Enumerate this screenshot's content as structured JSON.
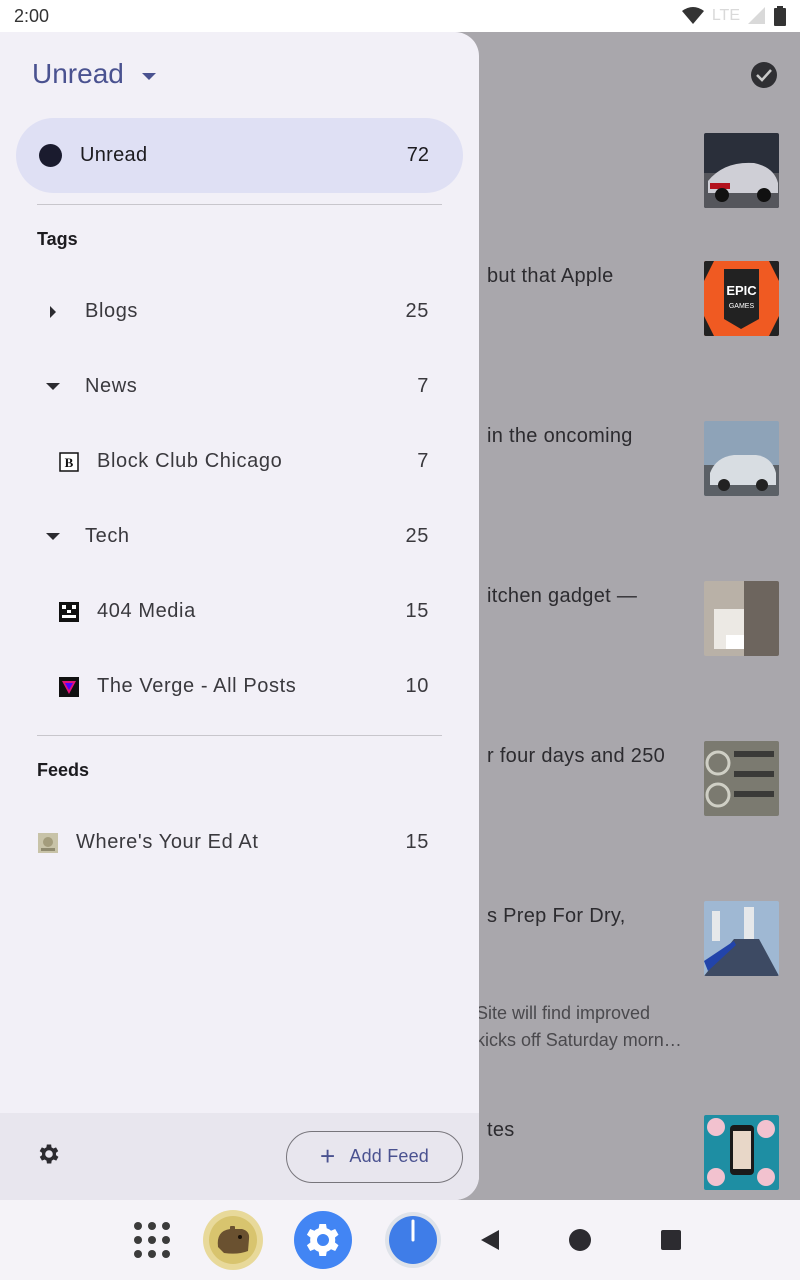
{
  "status_bar": {
    "time": "2:00",
    "network": "LTE"
  },
  "background": {
    "articles": [
      {
        "title": "",
        "thumb_colors": [
          "#2a2f3a",
          "#b3121d",
          "#cfcfd6"
        ]
      },
      {
        "title": "but that Apple",
        "thumb_colors": [
          "#f05a22",
          "#222222",
          "#ffffff"
        ]
      },
      {
        "title": "in the oncoming",
        "thumb_colors": [
          "#8ea3b8",
          "#d8dde2",
          "#5b6066"
        ]
      },
      {
        "title": "itchen gadget —",
        "thumb_colors": [
          "#b9b1a7",
          "#6d655e",
          "#ece9e4"
        ]
      },
      {
        "title": "r four days and 250",
        "thumb_colors": [
          "#7b7a70",
          "#3a3a38",
          "#cfcfc5"
        ]
      },
      {
        "title": "s Prep For Dry,",
        "thumb_colors": [
          "#9fb8d3",
          "#3d4a63",
          "#e6e8ea"
        ]
      },
      {
        "title": "tes",
        "thumb_colors": [
          "#1e8ea3",
          "#f2c2cf",
          "#1a1a1a"
        ]
      }
    ],
    "snippet_lines": [
      "Site will find improved",
      "kicks off Saturday morn…"
    ]
  },
  "drawer": {
    "header_label": "Unread",
    "unread_pill": {
      "label": "Unread",
      "count": "72"
    },
    "tags_label": "Tags",
    "tags": [
      {
        "label": "Blogs",
        "count": "25",
        "expanded": false
      },
      {
        "label": "News",
        "count": "7",
        "expanded": true,
        "feeds": [
          {
            "label": "Block Club Chicago",
            "count": "7",
            "icon": "block-club-icon"
          }
        ]
      },
      {
        "label": "Tech",
        "count": "25",
        "expanded": true,
        "feeds": [
          {
            "label": "404 Media",
            "count": "15",
            "icon": "404-media-icon"
          },
          {
            "label": "The Verge - All Posts",
            "count": "10",
            "icon": "verge-icon"
          }
        ]
      }
    ],
    "feeds_label": "Feeds",
    "feeds": [
      {
        "label": "Where's Your Ed At",
        "count": "15",
        "icon": "ed-at-icon"
      }
    ],
    "add_feed_label": "Add Feed",
    "add_feed_plus": "+"
  },
  "icons": {
    "block_club_letter": "B"
  },
  "colors": {
    "accent": "#4a5290",
    "pill_bg": "#dfe0f4",
    "drawer_bg": "#f2f0f7",
    "scrim": "#a9a7ac"
  }
}
